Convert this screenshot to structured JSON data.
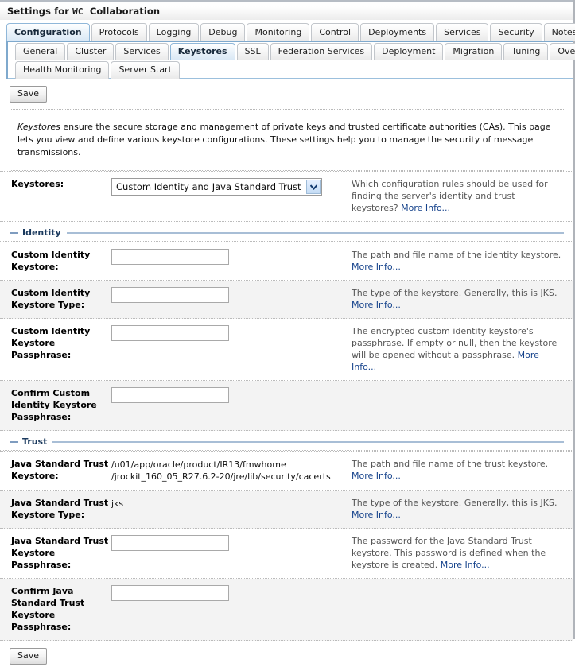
{
  "window": {
    "title_prefix": "Settings for",
    "title_mono": "WC",
    "title_suffix": "Collaboration"
  },
  "tabs_level1": [
    {
      "label": "Configuration",
      "active": true
    },
    {
      "label": "Protocols",
      "active": false
    },
    {
      "label": "Logging",
      "active": false
    },
    {
      "label": "Debug",
      "active": false
    },
    {
      "label": "Monitoring",
      "active": false
    },
    {
      "label": "Control",
      "active": false
    },
    {
      "label": "Deployments",
      "active": false
    },
    {
      "label": "Services",
      "active": false
    },
    {
      "label": "Security",
      "active": false
    },
    {
      "label": "Notes",
      "active": false
    }
  ],
  "tabs_level2": [
    {
      "label": "General",
      "active": false
    },
    {
      "label": "Cluster",
      "active": false
    },
    {
      "label": "Services",
      "active": false
    },
    {
      "label": "Keystores",
      "active": true
    },
    {
      "label": "SSL",
      "active": false
    },
    {
      "label": "Federation Services",
      "active": false
    },
    {
      "label": "Deployment",
      "active": false
    },
    {
      "label": "Migration",
      "active": false
    },
    {
      "label": "Tuning",
      "active": false
    },
    {
      "label": "Overload",
      "active": false
    }
  ],
  "tabs_level3": [
    {
      "label": "Health Monitoring",
      "active": false
    },
    {
      "label": "Server Start",
      "active": false
    }
  ],
  "toolbar": {
    "save_top_label": "Save",
    "save_bottom_label": "Save"
  },
  "intro": {
    "emphasis": "Keystores",
    "text": " ensure the secure storage and management of private keys and trusted certificate authorities (CAs). This page lets you view and define various keystore configurations. These settings help you to manage the security of message transmissions."
  },
  "keystores_row": {
    "label": "Keystores:",
    "selected": "Custom Identity and Java Standard Trust",
    "help": "Which configuration rules should be used for finding the server's identity and trust keystores?",
    "more_info": "More Info..."
  },
  "sections": {
    "identity": "Identity",
    "trust": "Trust"
  },
  "identity_rows": [
    {
      "label": "Custom Identity Keystore:",
      "kind": "input",
      "value": "",
      "help": "The path and file name of the identity keystore.",
      "more_info": "More Info..."
    },
    {
      "label": "Custom Identity Keystore Type:",
      "kind": "input",
      "value": "",
      "help": "The type of the keystore. Generally, this is JKS.",
      "more_info": "More Info..."
    },
    {
      "label": "Custom Identity Keystore Passphrase:",
      "kind": "input",
      "value": "",
      "help": "The encrypted custom identity keystore's passphrase. If empty or null, then the keystore will be opened without a passphrase.",
      "more_info": "More Info..."
    },
    {
      "label": "Confirm Custom Identity Keystore Passphrase:",
      "kind": "input",
      "value": "",
      "help": "",
      "more_info": ""
    }
  ],
  "trust_rows": [
    {
      "label": "Java Standard Trust Keystore:",
      "kind": "readonly",
      "value": "/u01/app/oracle/product/IR13/fmwhome /jrockit_160_05_R27.6.2-20/jre/lib/security/cacerts",
      "help": "The path and file name of the trust keystore.",
      "more_info": "More Info..."
    },
    {
      "label": "Java Standard Trust Keystore Type:",
      "kind": "readonly",
      "value": "jks",
      "help": "The type of the keystore. Generally, this is JKS.",
      "more_info": "More Info..."
    },
    {
      "label": "Java Standard Trust Keystore Passphrase:",
      "kind": "input",
      "value": "",
      "help": "The password for the Java Standard Trust keystore. This password is defined when the keystore is created.",
      "more_info": "More Info..."
    },
    {
      "label": "Confirm Java Standard Trust Keystore Passphrase:",
      "kind": "input",
      "value": "",
      "help": "",
      "more_info": ""
    }
  ],
  "colors": {
    "active_tab_bg": "#d8e7f5",
    "active_tab_border": "#8fb7d9",
    "section_label": "#1b3a5e",
    "link": "#16438c",
    "alt_row_bg": "#f3f3f3"
  }
}
